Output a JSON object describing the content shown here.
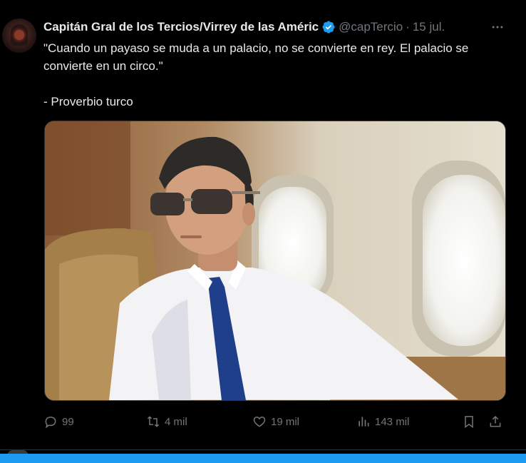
{
  "tweet": {
    "author_name": "Capitán Gral de los Tercios/Virrey de las Améric",
    "handle": "@capTercio",
    "separator": "·",
    "date": "15 jul.",
    "verified": true,
    "text_lines": [
      "\"Cuando un payaso se muda a un palacio, no se convierte en rey. El palacio se convierte en un circo.\"",
      "- Proverbio turco"
    ],
    "media_description_icon": "photo",
    "actions": {
      "replies": "99",
      "reposts": "4 mil",
      "likes": "19 mil",
      "views": "143 mil"
    }
  },
  "colors": {
    "background": "#000000",
    "text": "#e7e9ea",
    "muted": "#71767b",
    "accent": "#1d9bf0"
  }
}
